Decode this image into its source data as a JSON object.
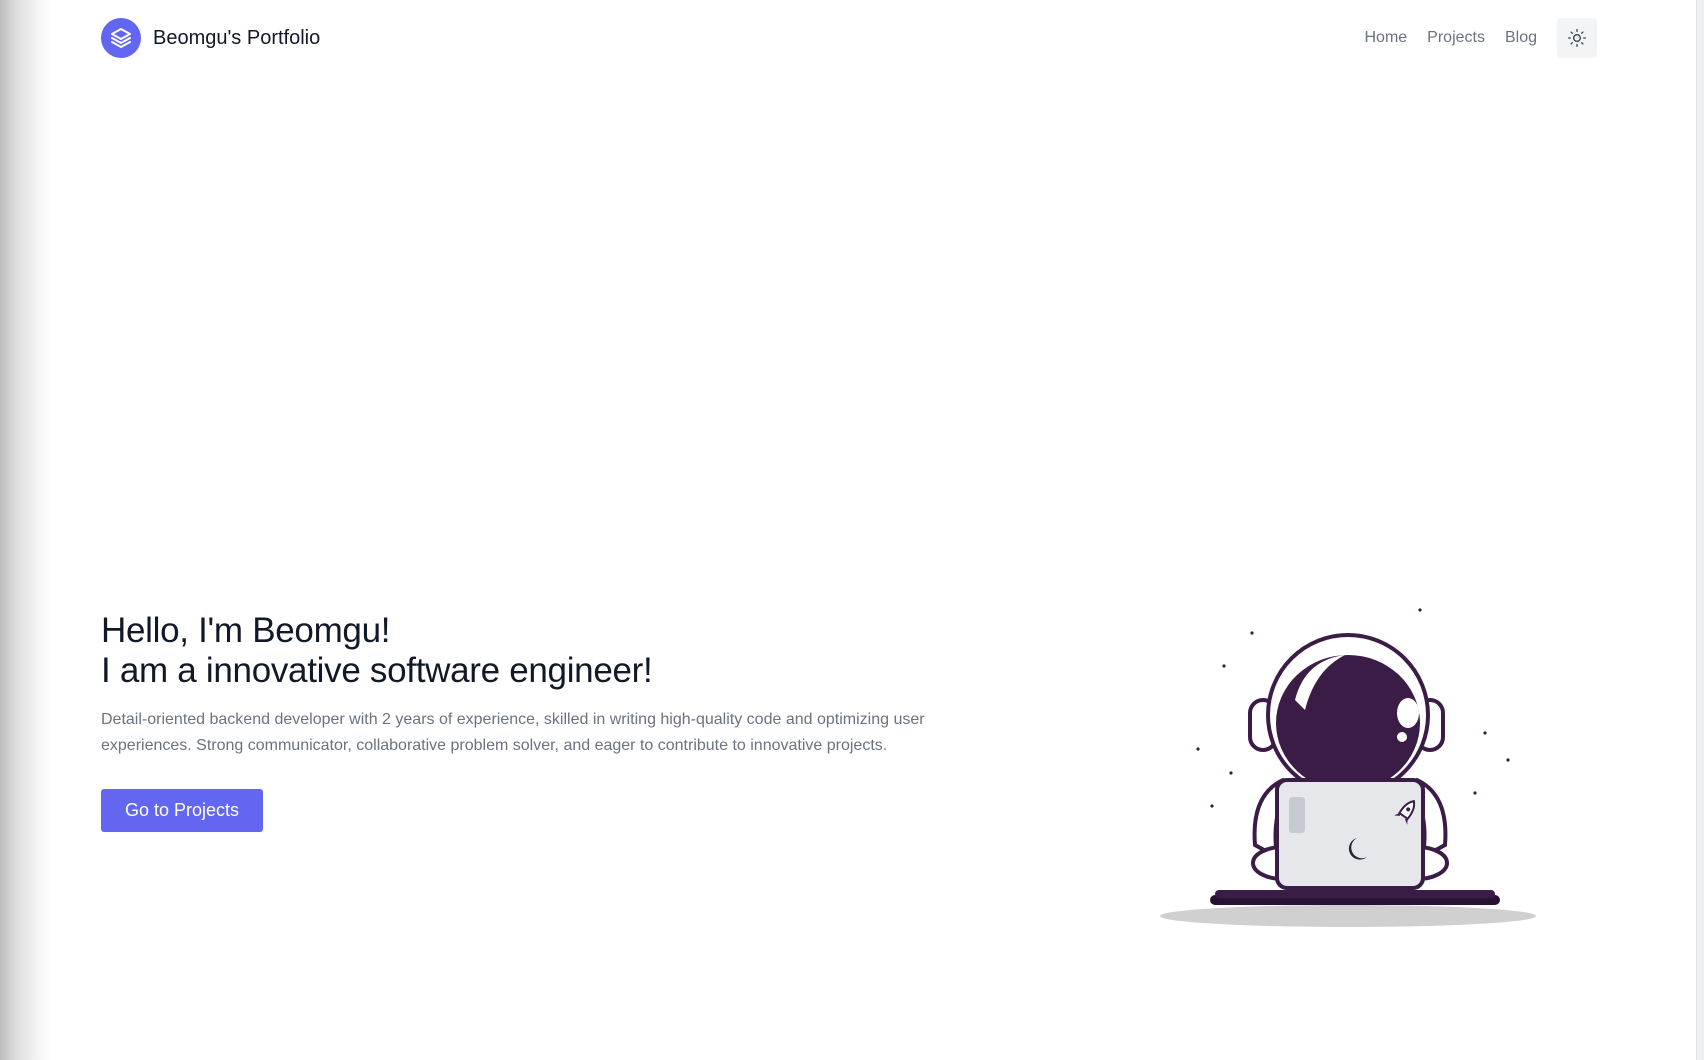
{
  "header": {
    "site_title": "Beomgu's Portfolio",
    "logo_icon": "layers-icon",
    "nav": [
      {
        "label": "Home"
      },
      {
        "label": "Projects"
      },
      {
        "label": "Blog"
      }
    ],
    "theme_toggle_icon": "sun-icon"
  },
  "hero": {
    "heading_line1": "Hello, I'm Beomgu!",
    "heading_line2": "I am a innovative software engineer!",
    "description": "Detail-oriented backend developer with 2 years of experience, skilled in writing high-quality code and optimizing user experiences. Strong communicator, collaborative problem solver, and eager to contribute to innovative projects.",
    "cta_label": "Go to Projects",
    "illustration": "astronaut-with-laptop-illustration"
  },
  "colors": {
    "accent": "#6366f1",
    "text_primary": "#111827",
    "text_muted": "#6b7280",
    "astronaut_purple": "#3b1c47"
  }
}
